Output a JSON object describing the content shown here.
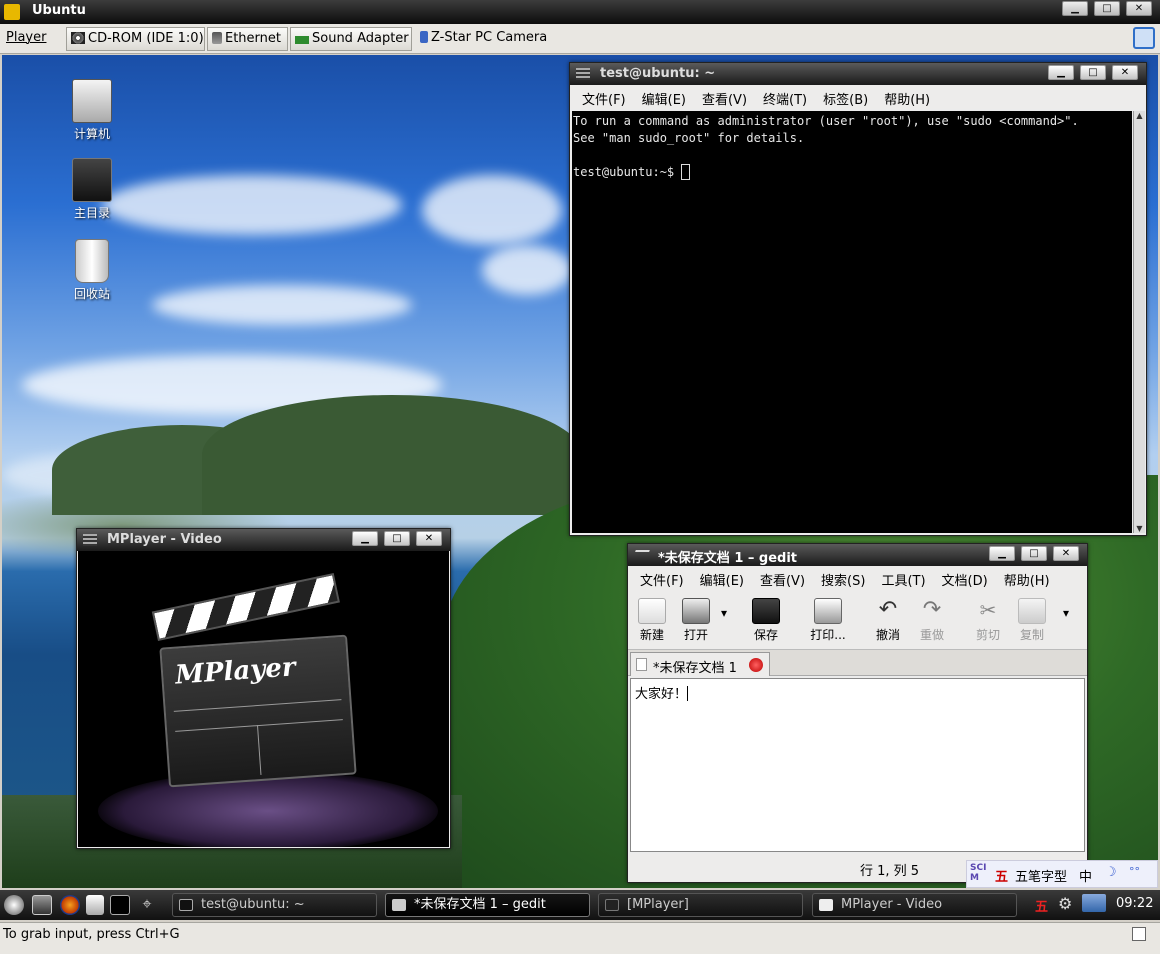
{
  "host": {
    "title": "Ubuntu",
    "menu_player": "Player",
    "devices": [
      "CD-ROM (IDE 1:0)",
      "Ethernet",
      "Sound Adapter",
      "Z-Star PC Camera"
    ],
    "status": "To grab input, press Ctrl+G"
  },
  "desktop_icons": [
    {
      "label": "计算机",
      "icon": "computer-icon"
    },
    {
      "label": "主目录",
      "icon": "home-folder-icon"
    },
    {
      "label": "回收站",
      "icon": "trash-icon"
    }
  ],
  "terminal": {
    "title": "test@ubuntu: ~",
    "menu": [
      "文件(F)",
      "编辑(E)",
      "查看(V)",
      "终端(T)",
      "标签(B)",
      "帮助(H)"
    ],
    "lines": [
      "To run a command as administrator (user \"root\"), use \"sudo <command>\".",
      "See \"man sudo_root\" for details.",
      "",
      "test@ubuntu:~$ "
    ]
  },
  "mplayer": {
    "title": "MPlayer - Video",
    "logo_text": "MPlayer"
  },
  "gedit": {
    "title": "*未保存文档 1 – gedit",
    "menu": [
      "文件(F)",
      "编辑(E)",
      "查看(V)",
      "搜索(S)",
      "工具(T)",
      "文档(D)",
      "帮助(H)"
    ],
    "toolbar": [
      {
        "label": "新建",
        "icon": "new-document-icon",
        "enabled": true
      },
      {
        "label": "打开",
        "icon": "open-icon",
        "enabled": true
      },
      {
        "label": "保存",
        "icon": "save-icon",
        "enabled": true
      },
      {
        "label": "打印...",
        "icon": "print-icon",
        "enabled": true
      },
      {
        "label": "撤消",
        "icon": "undo-icon",
        "enabled": true
      },
      {
        "label": "重做",
        "icon": "redo-icon",
        "enabled": false
      },
      {
        "label": "剪切",
        "icon": "cut-icon",
        "enabled": false
      },
      {
        "label": "复制",
        "icon": "copy-icon",
        "enabled": false
      }
    ],
    "tab_label": "*未保存文档 1",
    "content": "大家好！",
    "status_position": "行 1, 列 5"
  },
  "ime": {
    "logo": "SCIM",
    "wubi_char": "五",
    "mode": "五笔字型",
    "lang": "中"
  },
  "taskbar": {
    "tasks": [
      {
        "label": "test@ubuntu: ~",
        "active": false
      },
      {
        "label": "*未保存文档 1 – gedit",
        "active": true
      },
      {
        "label": "[MPlayer]",
        "active": false
      },
      {
        "label": "MPlayer - Video",
        "active": false
      }
    ],
    "tray_char": "五",
    "clock": "09:22"
  }
}
